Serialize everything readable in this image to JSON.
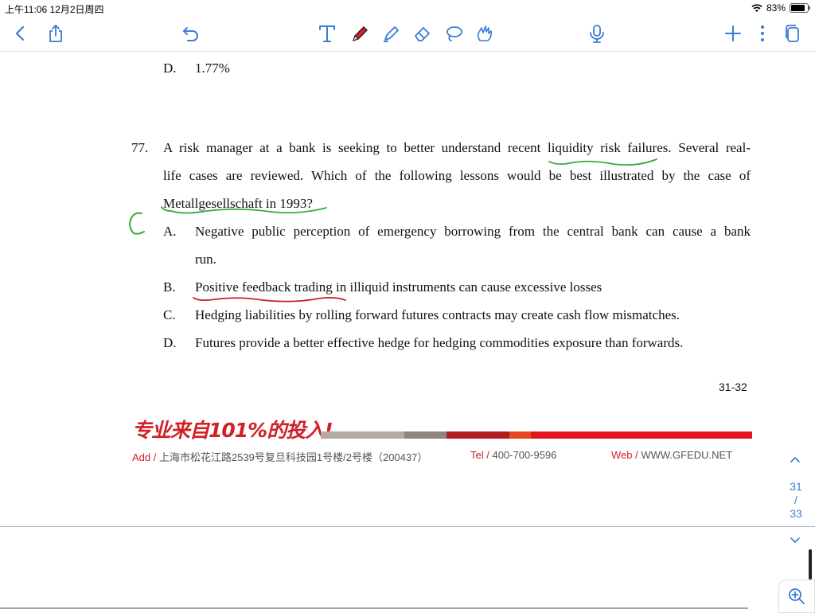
{
  "status_bar": {
    "time_date": "上午11:06   12月2日周四",
    "battery": "83%",
    "battery_level": 0.83
  },
  "toolbar": {
    "icons": [
      "back-icon",
      "share-icon",
      "undo-icon",
      "text-tool-icon",
      "pen-icon",
      "highlighter-icon",
      "eraser-icon",
      "lasso-icon",
      "shape-tool-icon",
      "microphone-icon",
      "add-icon",
      "more-icon",
      "pages-icon"
    ]
  },
  "document": {
    "prev_option": {
      "letter": "D.",
      "text": "1.77%"
    },
    "question": {
      "number": "77.",
      "line1": "A risk manager at a bank is seeking to better understand recent liquidity risk failures. Several real-",
      "line2": "life cases are reviewed. Which of the following lessons would be best illustrated by the case of",
      "line3": "Metallgesellschaft in 1993?"
    },
    "options": [
      {
        "letter": "A.",
        "line1": "Negative public perception of emergency borrowing from the central bank can cause a bank",
        "line2": "run."
      },
      {
        "letter": "B.",
        "text": "Positive feedback trading in illiquid instruments can cause excessive losses"
      },
      {
        "letter": "C.",
        "text": "Hedging liabilities by rolling forward futures contracts may create cash flow mismatches."
      },
      {
        "letter": "D.",
        "text": "Futures provide a better effective hedge for hedging commodities exposure than forwards."
      }
    ],
    "page_label": "31-32",
    "handwritten_answer": "C"
  },
  "footer": {
    "slogan": "专业来自101%的投入!",
    "add_label": "Add /",
    "address": "上海市松花江路2539号复旦科技园1号楼/2号楼（200437）",
    "tel_label": "Tel /",
    "tel": "400-700-9596",
    "web_label": "Web /",
    "web": "WWW.GFEDU.NET",
    "bar_colors": [
      "#b5aaa3",
      "#8f8580",
      "#b01e22",
      "#e84624",
      "#e3151f"
    ]
  },
  "page_nav": {
    "current": "31",
    "sep": "/",
    "total": "33"
  }
}
